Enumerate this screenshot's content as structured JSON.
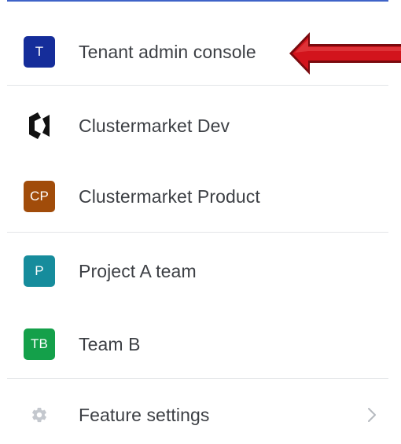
{
  "menu": {
    "items": [
      {
        "label": "Tenant admin console",
        "badge_text": "T",
        "badge_color": "#152d9a"
      },
      {
        "label": "Clustermarket Dev",
        "badge_icon": "clustermarket-logo-icon"
      },
      {
        "label": "Clustermarket Product",
        "badge_text": "CP",
        "badge_color": "#a14c0a"
      },
      {
        "label": "Project A team",
        "badge_text": "P",
        "badge_color": "#168c9c"
      },
      {
        "label": "Team B",
        "badge_text": "TB",
        "badge_color": "#14a04a"
      }
    ],
    "settings": {
      "label": "Feature settings",
      "icon": "gear-icon",
      "chevron_icon": "chevron-right-icon"
    }
  },
  "annotation": {
    "icon": "red-arrow-icon",
    "color": "#d2141c"
  },
  "colors": {
    "accent_border": "#3f63c8",
    "text": "#3c3f44",
    "divider": "#e3e5e8"
  }
}
